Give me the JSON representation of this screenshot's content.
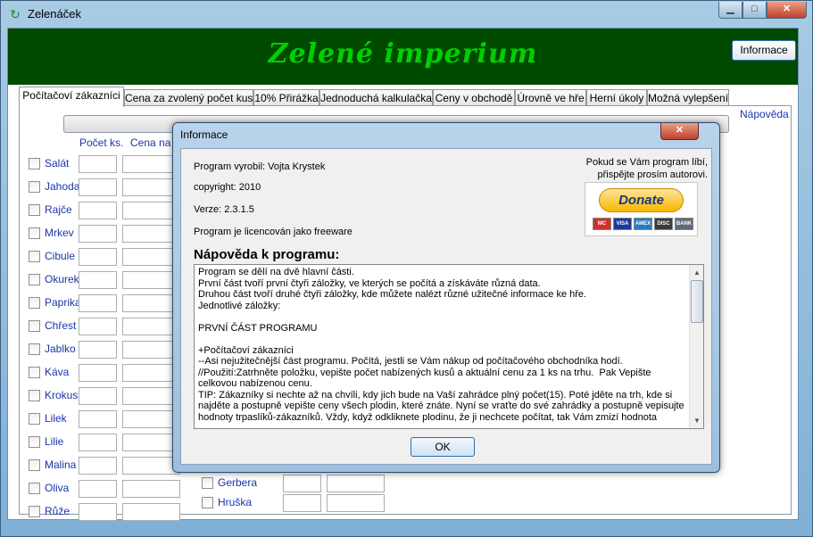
{
  "window": {
    "title": "Zelenáček",
    "min_icon": "minimize-icon",
    "max_icon": "maximize-icon",
    "close_icon": "close-icon"
  },
  "banner": {
    "title": "Zelené imperium",
    "info_button": "Informace"
  },
  "tabs": [
    {
      "label": "Počítačoví zákazníci",
      "active": true
    },
    {
      "label": "Cena za zvolený počet kusů"
    },
    {
      "label": "10% Přirážka"
    },
    {
      "label": "Jednoduchá kalkulačka"
    },
    {
      "label": "Ceny v obchodě"
    },
    {
      "label": "Úrovně ve hře"
    },
    {
      "label": "Herní úkoly"
    },
    {
      "label": "Možná vylepšení"
    }
  ],
  "main": {
    "help_link": "Nápověda",
    "columns": {
      "count": "Počet ks.",
      "price": "Cena na t"
    },
    "items_left": [
      "Salát",
      "Jahoda",
      "Rajče",
      "Mrkev",
      "Cibule",
      "Okurek",
      "Paprika",
      "Chřest",
      "Jablko",
      "Káva",
      "Krokus",
      "Lilek",
      "Lilie",
      "Malina",
      "Oliva",
      "Růže"
    ],
    "items_right": [
      "Gerbera",
      "Hruška"
    ]
  },
  "dialog": {
    "title": "Informace",
    "author": "Program vyrobil: Vojta Krystek",
    "copyright": "copyright: 2010",
    "version": "Verze: 2.3.1.5",
    "license": "Program je licencován jako freeware",
    "donate_note_1": "Pokud se Vám program líbí,",
    "donate_note_2": "přispějte prosím autorovi.",
    "donate_label": "Donate",
    "cards": [
      "MC",
      "VISA",
      "AMEX",
      "DISC",
      "BANK"
    ],
    "help_heading": "Nápověda k programu:",
    "help_text": "Program se dělí na dvě hlavní části.\nPrvní část tvoří první čtyři záložky, ve kterých se počítá a získáváte různá data.\nDruhou část tvoří druhé čtyři záložky, kde můžete nalézt různé užitečné informace ke hře.\nJednotlivé záložky:\n\nPRVNÍ ČÁST PROGRAMU\n\n+Počítačoví zákazníci\n--Asi nejužitečnější část programu. Počítá, jestli se Vám nákup od počítačového obchodníka hodí.\n//Použití:Zatrhněte položku, vepište počet nabízených kusů a aktuální cenu za 1 ks na trhu.  Pak Vepište celkovou nabízenou cenu.\nTIP: Zákazníky si nechte až na chvíli, kdy jich bude na Vaší zahrádce plný počet(15). Poté jděte na trh, kde si najděte a postupně vepište ceny všech plodin, které znáte. Nyní se vraťte do své zahrádky a postupně vepisujte hodnoty trpaslíků-zákazníků. Vždy, když odkliknete plodinu, že ji nechcete počítat, tak Vám zmizí hodnota",
    "ok": "OK"
  }
}
